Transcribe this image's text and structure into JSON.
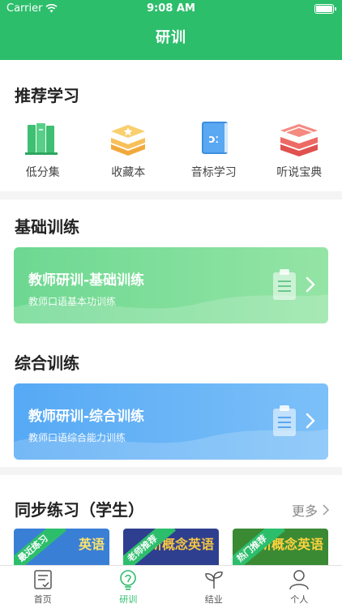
{
  "status": {
    "carrier": "Carrier",
    "time": "9:08 AM"
  },
  "header": {
    "title": "研训"
  },
  "recommend": {
    "title": "推荐学习",
    "items": [
      {
        "label": "低分集",
        "icon": "books-green-icon"
      },
      {
        "label": "收藏本",
        "icon": "books-star-icon"
      },
      {
        "label": "音标学习",
        "icon": "phonetic-book-icon"
      },
      {
        "label": "听说宝典",
        "icon": "books-red-icon"
      }
    ]
  },
  "basic": {
    "title": "基础训练",
    "card": {
      "title": "教师研训-基础训练",
      "subtitle": "教师口语基本功训练"
    }
  },
  "comprehensive": {
    "title": "综合训练",
    "card": {
      "title": "教师研训-综合训练",
      "subtitle": "教师口语综合能力训练"
    }
  },
  "sync": {
    "title": "同步练习（学生）",
    "more": "更多",
    "books": [
      {
        "ribbon": "最近练习",
        "cover": "英语"
      },
      {
        "ribbon": "老师推荐",
        "cover": "新概念英语"
      },
      {
        "ribbon": "热门推荐",
        "cover": "新概念英语"
      }
    ]
  },
  "tabs": [
    {
      "label": "首页",
      "icon": "home-checklist-icon"
    },
    {
      "label": "研训",
      "icon": "lightbulb-icon"
    },
    {
      "label": "结业",
      "icon": "sprout-icon"
    },
    {
      "label": "个人",
      "icon": "person-icon"
    }
  ],
  "colors": {
    "primary": "#2dbe6c",
    "green_card": "#7dde9a",
    "blue_card": "#62b0f6"
  }
}
